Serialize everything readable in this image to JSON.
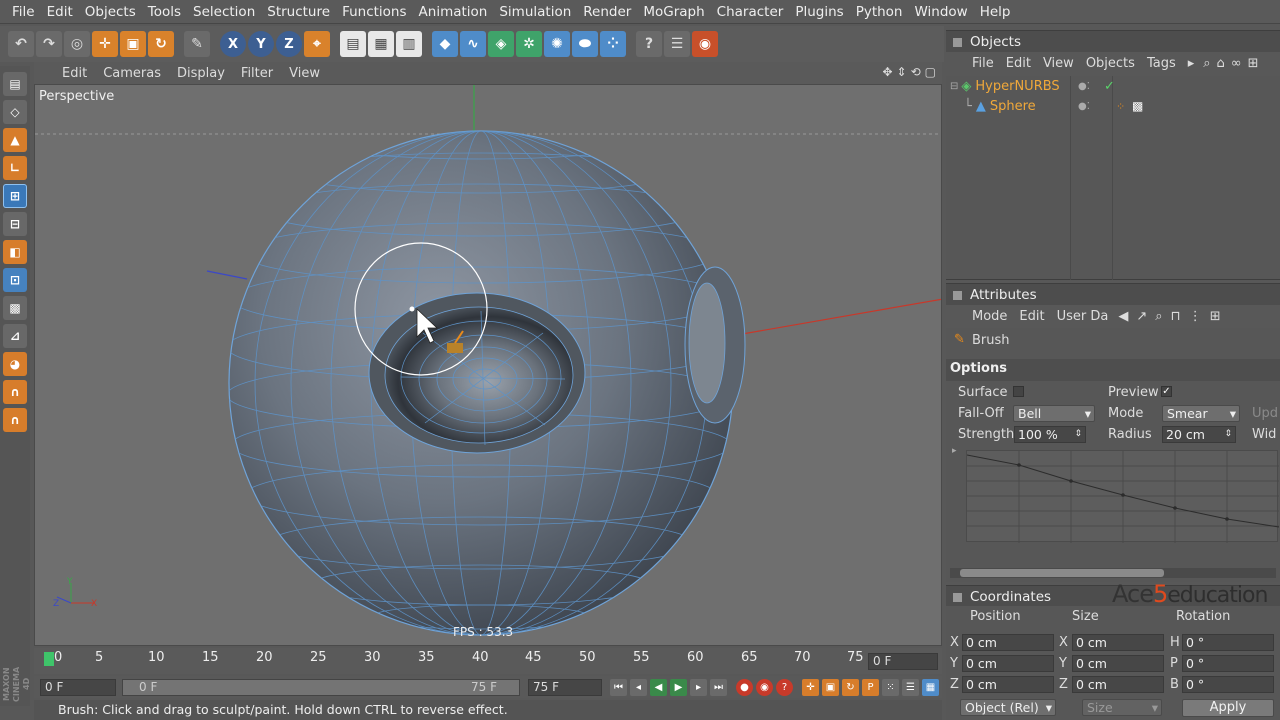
{
  "menubar": [
    "File",
    "Edit",
    "Objects",
    "Tools",
    "Selection",
    "Structure",
    "Functions",
    "Animation",
    "Simulation",
    "Render",
    "MoGraph",
    "Character",
    "Plugins",
    "Python",
    "Window",
    "Help"
  ],
  "toolbar": {
    "axis_x": "X",
    "axis_y": "Y",
    "axis_z": "Z"
  },
  "viewport": {
    "menu": [
      "Edit",
      "Cameras",
      "Display",
      "Filter",
      "View"
    ],
    "label": "Perspective",
    "fps": "FPS : 53.3"
  },
  "timeline": {
    "ticks": [
      "0",
      "5",
      "10",
      "15",
      "20",
      "25",
      "30",
      "35",
      "40",
      "45",
      "50",
      "55",
      "60",
      "65",
      "70",
      "75"
    ],
    "current_frame": "0 F",
    "start_field": "0 F",
    "range_start": "0 F",
    "range_end": "75 F",
    "end_field": "75 F"
  },
  "status": "Brush: Click and drag to sculpt/paint. Hold down CTRL to reverse effect.",
  "objects_panel": {
    "title": "Objects",
    "menu": [
      "File",
      "Edit",
      "View",
      "Objects",
      "Tags"
    ],
    "items": [
      {
        "name": "HyperNURBS"
      },
      {
        "name": "Sphere"
      }
    ]
  },
  "attributes_panel": {
    "title": "Attributes",
    "menu": [
      "Mode",
      "Edit",
      "User Da"
    ],
    "tool_name": "Brush",
    "section": "Options",
    "surface_label": "Surface",
    "preview_label": "Preview",
    "preview_checked": "✓",
    "falloff_label": "Fall-Off",
    "falloff_value": "Bell",
    "mode_label": "Mode",
    "mode_value": "Smear",
    "upd_label": "Upd",
    "strength_label": "Strength",
    "strength_value": "100 %",
    "radius_label": "Radius",
    "radius_value": "20 cm",
    "width_label": "Wid"
  },
  "coordinates_panel": {
    "title": "Coordinates",
    "col_position": "Position",
    "col_size": "Size",
    "col_rotation": "Rotation",
    "rows": [
      {
        "pos_axis": "X",
        "pos": "0 cm",
        "size_axis": "X",
        "size": "0 cm",
        "rot_axis": "H",
        "rot": "0 °"
      },
      {
        "pos_axis": "Y",
        "pos": "0 cm",
        "size_axis": "Y",
        "size": "0 cm",
        "rot_axis": "P",
        "rot": "0 °"
      },
      {
        "pos_axis": "Z",
        "pos": "0 cm",
        "size_axis": "Z",
        "size": "0 cm",
        "rot_axis": "B",
        "rot": "0 °"
      }
    ],
    "mode": "Object (Rel)",
    "size_mode": "Size",
    "apply": "Apply"
  },
  "watermark": {
    "ace": "Ace",
    "five": "5",
    "education": "education"
  },
  "logo": {
    "brand": "MAXON CINEMA 4D"
  }
}
